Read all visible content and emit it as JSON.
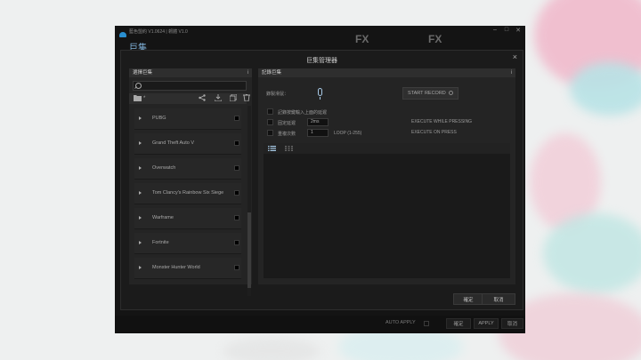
{
  "app": {
    "title": "藍色盟約 V1.0624 | 韌體 V1.0",
    "nav": "巨集",
    "brands": [
      "FX",
      "FX"
    ],
    "window_controls": [
      "‒",
      "□",
      "✕"
    ]
  },
  "footer": {
    "auto_apply": "AUTO APPLY",
    "confirm": "確定",
    "apply": "APPLY",
    "cancel": "取消"
  },
  "dialog": {
    "title": "巨集管理器",
    "close": "×",
    "left_panel": {
      "header": "選擇巨集",
      "info": "i",
      "search_placeholder": "",
      "folder_label": "*",
      "toolbar_icons": [
        "share-icon",
        "download-icon",
        "copy-icon",
        "trash-icon"
      ],
      "games": [
        "PUBG",
        "Grand Theft Auto V",
        "Overwatch",
        "Tom Clancy's Rainbow Six Siege",
        "Warframe",
        "Fortnite",
        "Monster Hunter World"
      ]
    },
    "right_panel": {
      "header": "記錄巨集",
      "info": "i",
      "record_label": "錄製滑鼠：",
      "start_record": "START RECORD",
      "options": {
        "record_mouse_move": "記錄按鍵輸入上面的延遲",
        "fixed_delay": "固定延遲",
        "fixed_delay_value": "2ms",
        "repeat": "重複次數",
        "repeat_value": "1",
        "loop": "LOOP (1-255)",
        "execute_while_pressing": "EXECUTE WHILE PRESSING",
        "execute_on_press": "EXECUTE ON PRESS"
      }
    },
    "buttons": {
      "ok": "確定",
      "cancel": "取消"
    }
  },
  "colors": {
    "accent": "#a7c9e6",
    "app_bg": "#141414",
    "dialog_bg": "#1b1b1b",
    "panel_bg": "#242424"
  }
}
